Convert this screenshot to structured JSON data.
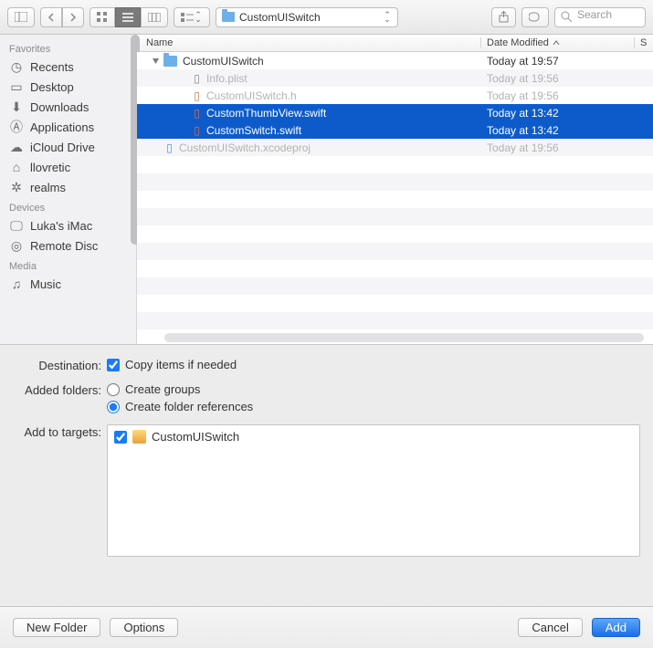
{
  "toolbar": {
    "path_label": "CustomUISwitch",
    "search_placeholder": "Search"
  },
  "sidebar": {
    "sections": [
      {
        "title": "Favorites",
        "items": [
          "Recents",
          "Desktop",
          "Downloads",
          "Applications",
          "iCloud Drive",
          "llovretic",
          "realms"
        ]
      },
      {
        "title": "Devices",
        "items": [
          "Luka's iMac",
          "Remote Disc"
        ]
      },
      {
        "title": "Media",
        "items": [
          "Music"
        ]
      }
    ]
  },
  "file_headers": {
    "name": "Name",
    "date": "Date Modified",
    "s": "S"
  },
  "files": [
    {
      "name": "CustomUISwitch",
      "date": "Today at 19:57",
      "kind": "folder",
      "indent": 0,
      "sel": false,
      "dim": false,
      "expanded": true
    },
    {
      "name": "Info.plist",
      "date": "Today at 19:56",
      "kind": "plist",
      "indent": 1,
      "sel": false,
      "dim": true
    },
    {
      "name": "CustomUISwitch.h",
      "date": "Today at 19:56",
      "kind": "h",
      "indent": 1,
      "sel": false,
      "dim": true
    },
    {
      "name": "CustomThumbView.swift",
      "date": "Today at 13:42",
      "kind": "swift",
      "indent": 1,
      "sel": true,
      "dim": false
    },
    {
      "name": "CustomSwitch.swift",
      "date": "Today at 13:42",
      "kind": "swift",
      "indent": 1,
      "sel": true,
      "dim": false
    },
    {
      "name": "CustomUISwitch.xcodeproj",
      "date": "Today at 19:56",
      "kind": "proj",
      "indent": 0,
      "sel": false,
      "dim": true
    }
  ],
  "options": {
    "destination_label": "Destination:",
    "copy_items": "Copy items if needed",
    "added_folders_label": "Added folders:",
    "create_groups": "Create groups",
    "create_refs": "Create folder references",
    "add_targets_label": "Add to targets:",
    "target_name": "CustomUISwitch"
  },
  "footer": {
    "new_folder": "New Folder",
    "options": "Options",
    "cancel": "Cancel",
    "add": "Add"
  }
}
